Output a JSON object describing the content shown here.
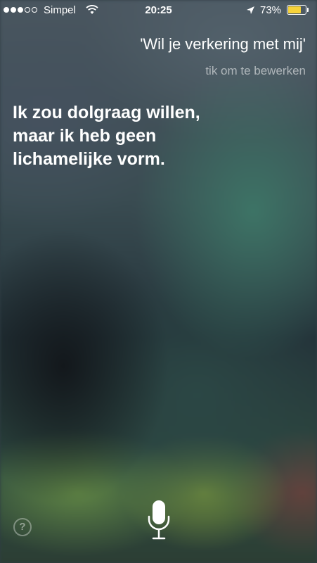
{
  "status_bar": {
    "signal_bars_total": 5,
    "signal_bars_filled": 3,
    "carrier": "Simpel",
    "time": "20:25",
    "battery_percent": "73%",
    "battery_level": 0.73,
    "battery_color": "#f7d33a",
    "icons": [
      "wifi-icon",
      "location-arrow-icon",
      "battery-icon"
    ]
  },
  "siri": {
    "query": "'Wil je verkering met mij'",
    "edit_hint": "tik om te bewerken",
    "reply": "Ik zou dolgraag willen,\nmaar ik heb geen\nlichamelijke vorm."
  },
  "controls": {
    "help_label": "?",
    "help_icon": "question-mark-icon",
    "mic_icon": "microphone-icon"
  }
}
